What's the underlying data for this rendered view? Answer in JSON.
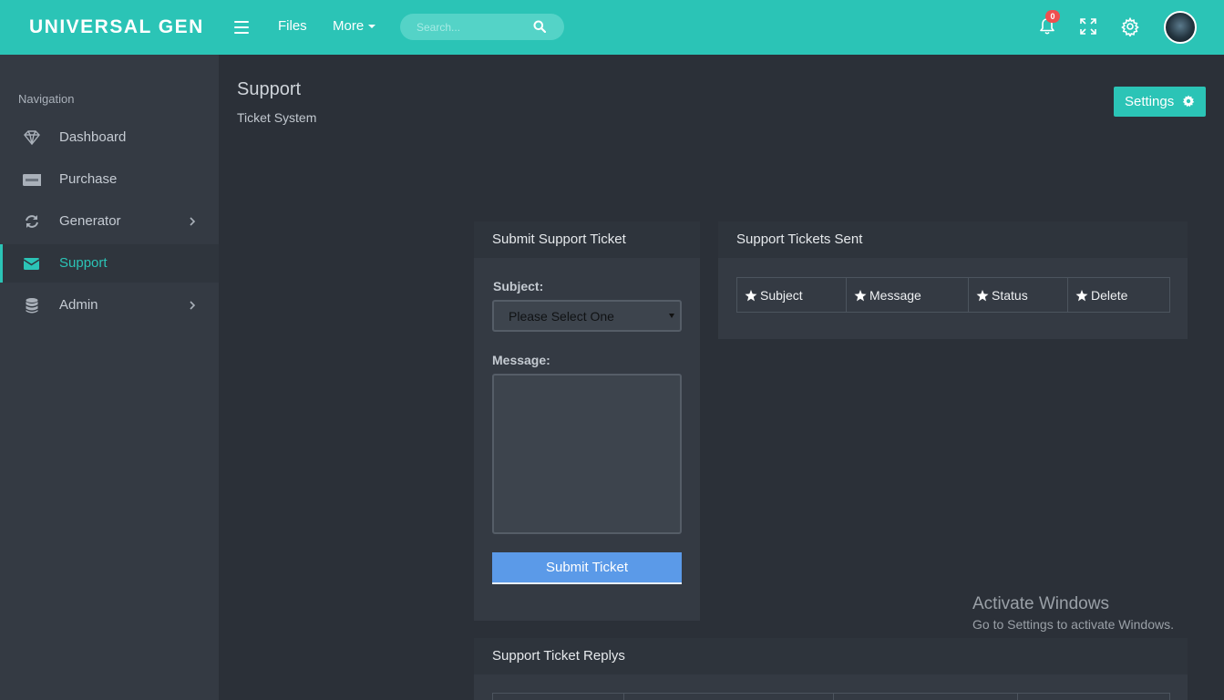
{
  "app": {
    "brand": "UNIVERSAL GEN"
  },
  "topnav": {
    "files_label": "Files",
    "more_label": "More",
    "search_placeholder": "Search...",
    "notification_count": "0"
  },
  "sidebar": {
    "heading": "Navigation",
    "items": [
      {
        "label": "Dashboard",
        "icon": "diamond-icon",
        "has_submenu": false,
        "active": false
      },
      {
        "label": "Purchase",
        "icon": "paypal-icon",
        "has_submenu": false,
        "active": false
      },
      {
        "label": "Generator",
        "icon": "refresh-icon",
        "has_submenu": true,
        "active": false
      },
      {
        "label": "Support",
        "icon": "envelope-icon",
        "has_submenu": false,
        "active": true
      },
      {
        "label": "Admin",
        "icon": "database-icon",
        "has_submenu": true,
        "active": false
      }
    ]
  },
  "page": {
    "title": "Support",
    "subtitle": "Ticket System",
    "settings_label": "Settings"
  },
  "ticket_form": {
    "title": "Submit Support Ticket",
    "subject_label": "Subject:",
    "subject_value": "Please Select One",
    "message_label": "Message:",
    "message_value": "",
    "submit_label": "Submit Ticket"
  },
  "tickets_sent": {
    "title": "Support Tickets Sent",
    "columns": [
      "Subject",
      "Message",
      "Status",
      "Delete"
    ]
  },
  "replies": {
    "title": "Support Ticket Replys"
  },
  "watermark": {
    "line1": "Activate Windows",
    "line2": "Go to Settings to activate Windows."
  },
  "colors": {
    "accent": "#2bc4b6",
    "submit": "#5b9ae8",
    "badge": "#ef4f4f",
    "background": "#2b3038",
    "panel": "#343a43"
  }
}
